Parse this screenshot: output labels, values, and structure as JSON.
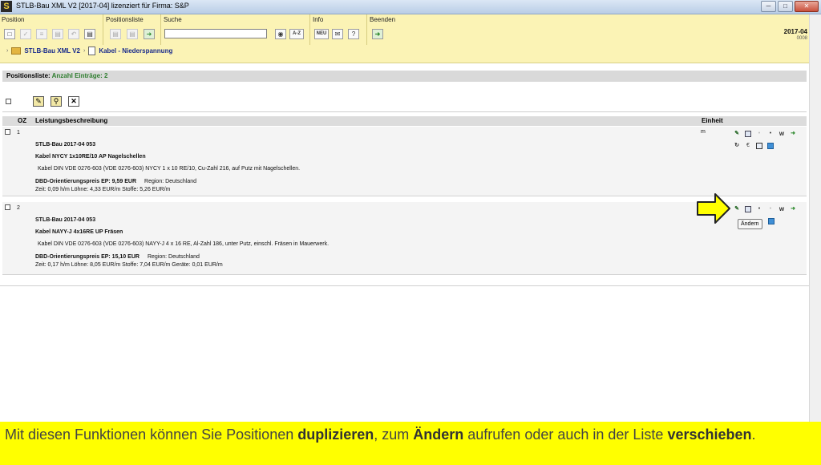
{
  "window": {
    "title": "STLB-Bau XML V2 [2017-04] lizenziert für Firma: S&P",
    "app_icon": "S"
  },
  "toolbar": {
    "groups": {
      "position": "Position",
      "positionsliste": "Positionsliste",
      "suche": "Suche",
      "info": "Info",
      "beenden": "Beenden"
    },
    "search_value": "",
    "az_label": "A-Z",
    "neu_label": "NEU",
    "help_label": "?",
    "version_year": "2017-04",
    "version_sub": "0008"
  },
  "breadcrumb": {
    "root": "STLB-Bau XML V2",
    "current": "Kabel - Niederspannung"
  },
  "list": {
    "header_label": "Positionsliste:",
    "header_count": "Anzahl Einträge: 2",
    "columns": {
      "oz": "OZ",
      "beschreibung": "Leistungsbeschreibung",
      "einheit": "Einheit"
    },
    "rows": [
      {
        "oz": "1",
        "unit": "m",
        "catalog": "STLB-Bau 2017-04 053",
        "short": "Kabel NYCY 1x10RE/10 AP Nagelschellen",
        "long": "Kabel DIN VDE 0276-603 (VDE 0276-603) NYCY 1 x 10 RE/10, Cu-Zahl 216, auf Putz mit Nagelschellen.",
        "price_label": "DBD-Orientierungspreis EP: 9,59 EUR",
        "region": "Region: Deutschland",
        "details": "Zeit: 0,09 h/m   Löhne: 4,33 EUR/m   Stoffe: 5,26 EUR/m"
      },
      {
        "oz": "2",
        "unit": "",
        "catalog": "STLB-Bau 2017-04 053",
        "short": "Kabel NAYY-J 4x16RE UP Fräsen",
        "long": "Kabel DIN VDE 0276-603 (VDE 0276-603) NAYY-J 4 x 16 RE, Al-Zahl 186, unter Putz, einschl. Fräsen in Mauerwerk.",
        "price_label": "DBD-Orientierungspreis EP: 15,10 EUR",
        "region": "Region: Deutschland",
        "details": "Zeit: 0,17 h/m   Löhne: 8,05 EUR/m   Stoffe: 7,04 EUR/m   Geräte: 0,01 EUR/m"
      }
    ],
    "tooltip": "Ändern"
  },
  "caption": {
    "part1": "Mit diesen Funktionen können Sie Positionen ",
    "bold1": "duplizieren",
    "part2": ", zum ",
    "bold2": "Ändern",
    "part3": " aufrufen oder auch in der Liste ",
    "bold3": "verschieben",
    "part4": "."
  },
  "colors": {
    "toolbar_bg": "#fbf3b5",
    "caption_bg": "#ffff00",
    "count_green": "#2e7d2e",
    "link_blue": "#1a2c8c",
    "arrow_yellow": "#ffff00"
  }
}
